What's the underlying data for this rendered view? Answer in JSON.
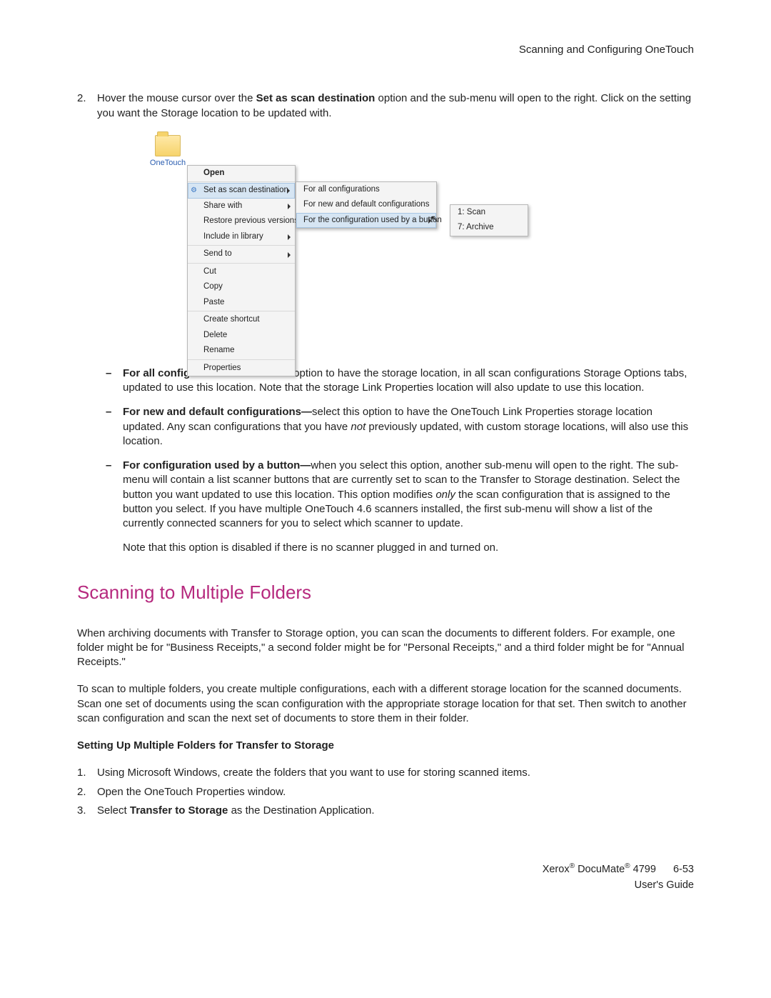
{
  "header": {
    "title": "Scanning and Configuring OneTouch"
  },
  "step": {
    "num": "2.",
    "text_a": "Hover the mouse cursor over the ",
    "text_b": "Set as scan destination",
    "text_c": " option and the sub-menu will open to the right. Click on the setting you want the Storage location to be updated with."
  },
  "folder": {
    "label": "OneTouch"
  },
  "menu": {
    "open": "Open",
    "set": "Set as scan destination",
    "share": "Share with",
    "restore": "Restore previous versions",
    "include": "Include in library",
    "send": "Send to",
    "cut": "Cut",
    "copy": "Copy",
    "paste": "Paste",
    "shortcut": "Create shortcut",
    "delete": "Delete",
    "rename": "Rename",
    "props": "Properties"
  },
  "submenu": {
    "all": "For all configurations",
    "newdef": "For new and default configurations",
    "bybutton": "For the configuration used by a button"
  },
  "submenu2": {
    "scan": "1: Scan",
    "archive": "7: Archive"
  },
  "bullets": {
    "b1_t": "For all configurations—",
    "b1_b": "select this option to have the storage location, in all scan configurations Storage Options tabs, updated to use this location. Note that the storage Link Properties location will also update to use this location.",
    "b2_t": "For new and default configurations—",
    "b2_b": "select this option to have the OneTouch Link Properties storage location updated. Any scan configurations that you have ",
    "b2_i": "not",
    "b2_c": " previously updated, with custom storage locations, will also use this location.",
    "b3_t": "For configuration used by a button—",
    "b3_b": "when you select this option, another sub-menu will open to the right. The sub-menu will contain a list scanner buttons that are currently set to scan to the Transfer to Storage destination. Select the button you want updated to use this location. This option modifies ",
    "b3_i": "only",
    "b3_c": " the scan configuration that is assigned to the button you select. If you have multiple OneTouch 4.6 scanners installed, the first sub-menu will show a list of the currently connected scanners for you to select which scanner to update.",
    "note": "Note that this option is disabled if there is no scanner plugged in and turned on."
  },
  "section": {
    "title": "Scanning to Multiple Folders"
  },
  "body": {
    "p1": "When archiving documents with Transfer to Storage option, you can scan the documents to different folders. For example, one folder might be for \"Business Receipts,\" a second folder might be for \"Personal Receipts,\" and a third folder might be for \"Annual Receipts.\"",
    "p2": "To scan to multiple folders, you create multiple configurations, each with a different storage location for the scanned documents. Scan one set of documents using the scan configuration with the appropriate storage location for that set. Then switch to another scan configuration and scan the next set of documents to store them in their folder.",
    "h": "Setting Up Multiple Folders for Transfer to Storage",
    "o1n": "1.",
    "o1": "Using Microsoft Windows, create the folders that you want to use for storing scanned items.",
    "o2n": "2.",
    "o2": "Open the OneTouch Properties window.",
    "o3n": "3.",
    "o3a": "Select ",
    "o3b": "Transfer to Storage",
    "o3c": " as the Destination Application."
  },
  "footer": {
    "line1a": "Xerox",
    "line1b": " DocuMate",
    "line1c": " 4799",
    "page": "6-53",
    "line2": "User's Guide"
  }
}
